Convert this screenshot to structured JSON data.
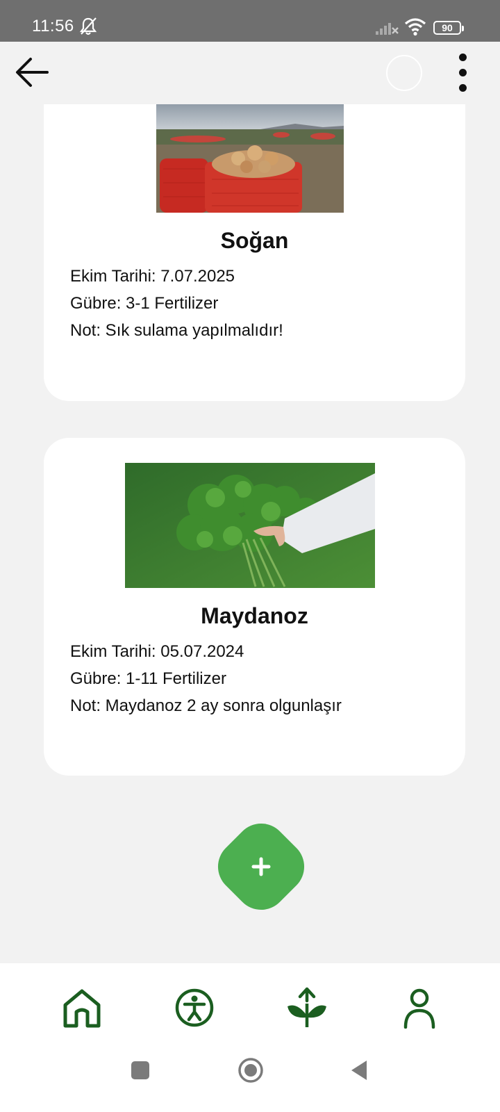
{
  "status": {
    "time": "11:56",
    "battery": "90"
  },
  "appbar": {
    "back_icon": "arrow-left-icon",
    "more_icon": "more-vertical-icon"
  },
  "plants": [
    {
      "name": "Soğan",
      "planting_date": "Ekim Tarihi: 7.07.2025",
      "fertilizer": "Gübre: 3-1 Fertilizer",
      "note": "Not: Sık sulama yapılmalıdır!",
      "image": "onion-sacks-field-photo"
    },
    {
      "name": "Maydanoz",
      "planting_date": "Ekim Tarihi: 05.07.2024",
      "fertilizer": "Gübre: 1-11 Fertilizer",
      "note": "Not: Maydanoz 2 ay sonra olgunlaşır",
      "image": "parsley-bunch-photo"
    }
  ],
  "fab": {
    "icon": "plus-icon"
  },
  "bottom_nav": {
    "items": [
      "home-icon",
      "accessibility-icon",
      "plant-icon",
      "profile-icon"
    ],
    "color": "#1b5e20"
  },
  "colors": {
    "accent": "#4caf50",
    "nav": "#1b5e20"
  }
}
